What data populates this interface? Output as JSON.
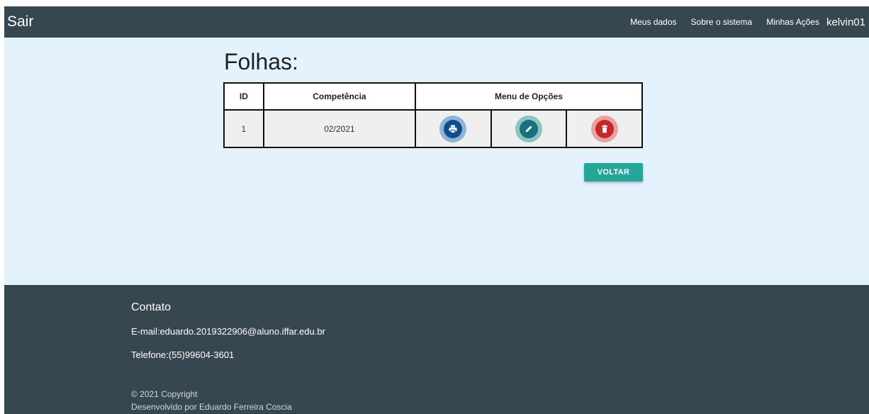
{
  "navbar": {
    "brand": "Sair",
    "links": [
      "Meus dados",
      "Sobre o sistema",
      "Minhas Ações"
    ],
    "user": "kelvin01"
  },
  "main": {
    "title": "Folhas:",
    "table": {
      "headers": {
        "id": "ID",
        "competencia": "Competência",
        "menu": "Menu de Opções"
      },
      "rows": [
        {
          "id": "1",
          "competencia": "02/2021"
        }
      ],
      "actions": [
        {
          "icon": "print-icon",
          "color": "#0d4f8b"
        },
        {
          "icon": "edit-icon",
          "color": "#17717a"
        },
        {
          "icon": "delete-icon",
          "color": "#c62828"
        }
      ]
    },
    "back_button": "VOLTAR"
  },
  "footer": {
    "title": "Contato",
    "email": "E-mail:eduardo.2019322906@aluno.iffar.edu.br",
    "phone": "Telefone:(55)99604-3601",
    "copyright": "© 2021 Copyright",
    "developer": "Desenvolvido por Eduardo Ferreira Coscia"
  },
  "colors": {
    "navbar": "#37474f",
    "background": "#e3f2fd",
    "accent": "#26a69a"
  }
}
